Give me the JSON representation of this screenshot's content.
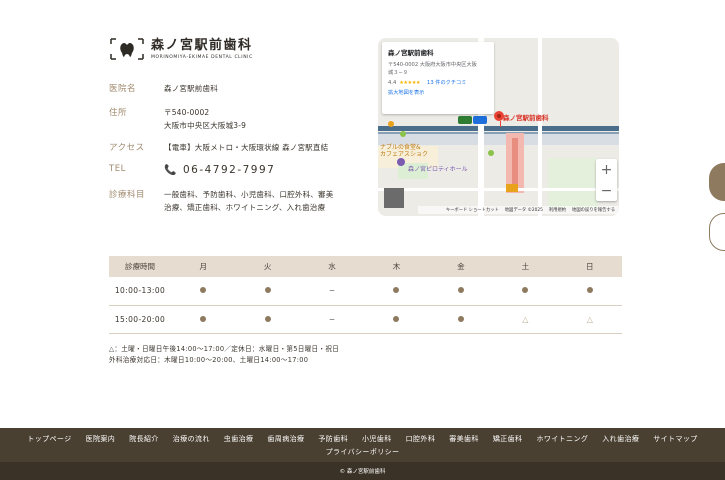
{
  "logo": {
    "name_ja": "森ノ宮駅前歯科",
    "name_en": "MORINOMIYA-EKIMAE DENTAL CLINIC"
  },
  "info": {
    "clinic_label": "医院名",
    "clinic_value": "森ノ宮駅前歯科",
    "address_label": "住所",
    "address_postal": "〒540-0002",
    "address_line": "大阪市中央区大阪城3-9",
    "access_label": "アクセス",
    "access_value": "【電車】大阪メトロ・大阪環状線 森ノ宮駅直結",
    "tel_label": "TEL",
    "tel_value": "06-4792-7997",
    "dept_label": "診療科目",
    "dept_value_1": "一般歯科、予防歯科、小児歯科、口腔外科、審美",
    "dept_value_2": "治療、矯正歯科、ホワイトニング、入れ歯治療"
  },
  "map": {
    "place_title": "森ノ宮駅前歯科",
    "place_address_1": "〒540-0002 大阪府大阪市中央区大阪",
    "place_address_2": "城３−９",
    "rating": "4.4",
    "stars": "★★★★★",
    "reviews": "13 件のクチコミ",
    "enlarge_link": "拡大地図を表示",
    "pin_label": "森ノ宮駅前歯科",
    "label_cafe": "ナブルの食堂&",
    "label_cafe2": "カフェアスショク",
    "label_piloti": "森ノ宮ピロティホール",
    "zoom_in": "+",
    "zoom_out": "−",
    "footer_shortcuts": "キーボード ショートカット",
    "footer_data": "地図データ ©2025",
    "footer_terms": "利用規約",
    "footer_report": "地図の誤りを報告する"
  },
  "schedule": {
    "headers": [
      "診療時間",
      "月",
      "火",
      "水",
      "木",
      "金",
      "土",
      "日"
    ],
    "rows": [
      {
        "time": "10:00-13:00",
        "marks": [
          "dot",
          "dot",
          "dash",
          "dot",
          "dot",
          "dot",
          "dot"
        ]
      },
      {
        "time": "15:00-20:00",
        "marks": [
          "dot",
          "dot",
          "dash",
          "dot",
          "dot",
          "tri",
          "tri"
        ]
      }
    ],
    "dash_symbol": "−",
    "tri_symbol": "△"
  },
  "notes": {
    "line1": "△：土曜・日曜日午後14:00〜17:00／定休日：水曜日・第5日曜日・祝日",
    "line2": "外科治療対応日：木曜日10:00〜20:00、土曜日14:00〜17:00"
  },
  "footer": {
    "nav": [
      "トップページ",
      "医院案内",
      "院長紹介",
      "治療の流れ",
      "虫歯治療",
      "歯周病治療",
      "予防歯科",
      "小児歯科",
      "口腔外科",
      "審美歯科",
      "矯正歯科",
      "ホワイトニング",
      "入れ歯治療",
      "サイトマップ"
    ],
    "privacy": "プライバシーポリシー",
    "copyright": "© 森ノ宮駅前歯科"
  },
  "colors": {
    "accent": "#8e7a5f",
    "footer_bg": "#4a4032",
    "header_bg": "#e6ddd0"
  }
}
